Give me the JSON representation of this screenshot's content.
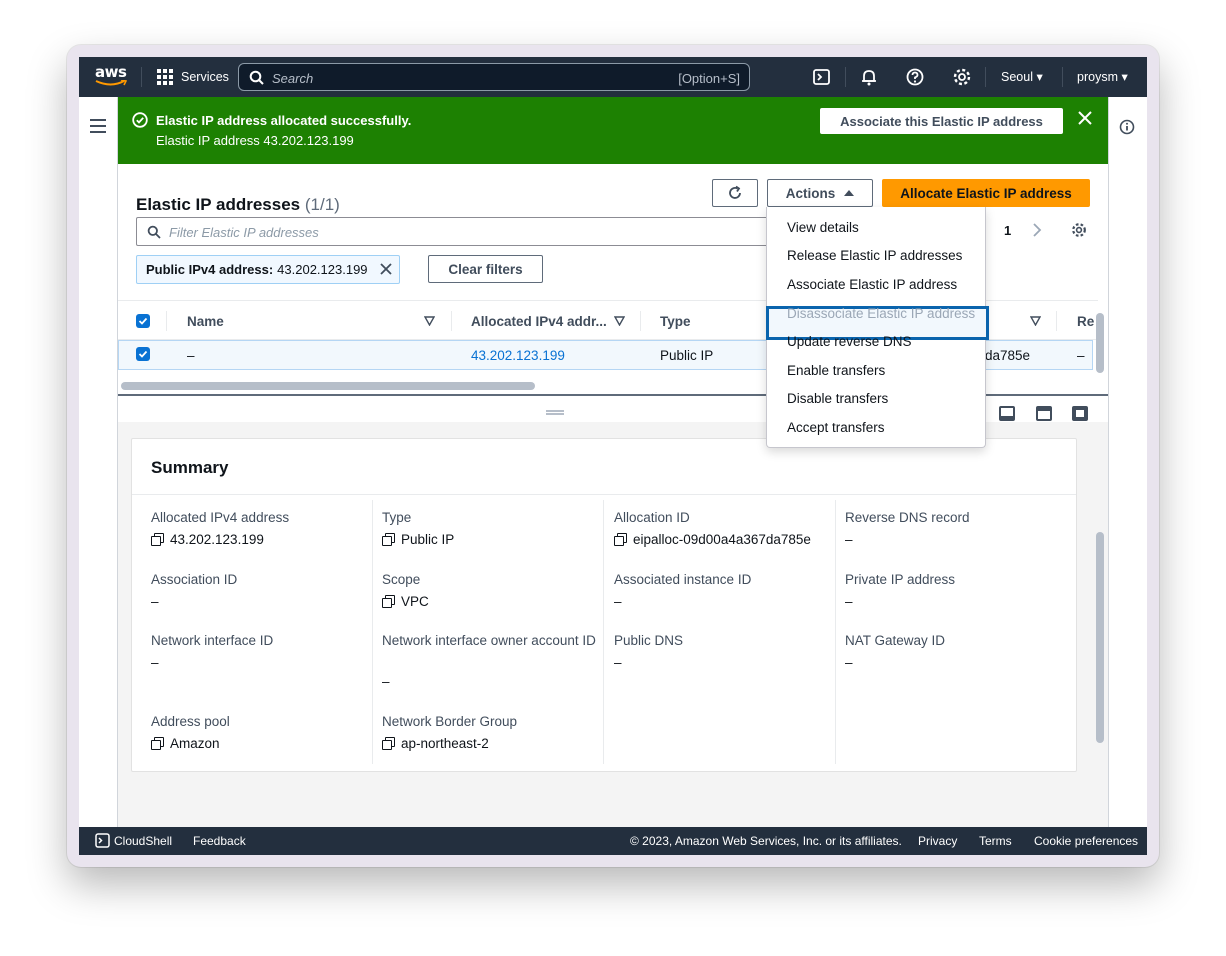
{
  "nav": {
    "logo_text": "aws",
    "services_label": "Services",
    "search_placeholder": "Search",
    "search_shortcut": "[Option+S]",
    "region": "Seoul",
    "user": "proysm"
  },
  "flash": {
    "title": "Elastic IP address allocated successfully.",
    "message": "Elastic IP address 43.202.123.199",
    "action_label": "Associate this Elastic IP address"
  },
  "header": {
    "title": "Elastic IP addresses",
    "count": "(1/1)",
    "actions_label": "Actions",
    "allocate_label": "Allocate Elastic IP address"
  },
  "filter": {
    "placeholder": "Filter Elastic IP addresses",
    "page": "1",
    "token_key": "Public IPv4 address:",
    "token_value": "43.202.123.199",
    "clear_label": "Clear filters"
  },
  "table": {
    "columns": [
      "Name",
      "Allocated IPv4 addr...",
      "Type",
      "Re"
    ],
    "row": {
      "name": "–",
      "ip": "43.202.123.199",
      "type": "Public IP",
      "alloc_tail": "da785e",
      "reverse": "–"
    }
  },
  "actions_menu": {
    "items": [
      {
        "label": "View details",
        "disabled": false
      },
      {
        "label": "Release Elastic IP addresses",
        "disabled": false
      },
      {
        "label": "Associate Elastic IP address",
        "disabled": false,
        "highlighted": true
      },
      {
        "label": "Disassociate Elastic IP address",
        "disabled": true
      },
      {
        "label": "Update reverse DNS",
        "disabled": false
      },
      {
        "label": "Enable transfers",
        "disabled": false
      },
      {
        "label": "Disable transfers",
        "disabled": false
      },
      {
        "label": "Accept transfers",
        "disabled": false
      }
    ]
  },
  "summary": {
    "title": "Summary",
    "allocated_ipv4_label": "Allocated IPv4 address",
    "allocated_ipv4_value": "43.202.123.199",
    "type_label": "Type",
    "type_value": "Public IP",
    "allocation_id_label": "Allocation ID",
    "allocation_id_value": "eipalloc-09d00a4a367da785e",
    "reverse_dns_label": "Reverse DNS record",
    "reverse_dns_value": "–",
    "association_id_label": "Association ID",
    "association_id_value": "–",
    "scope_label": "Scope",
    "scope_value": "VPC",
    "assoc_instance_label": "Associated instance ID",
    "assoc_instance_value": "–",
    "private_ip_label": "Private IP address",
    "private_ip_value": "–",
    "eni_label": "Network interface ID",
    "eni_value": "–",
    "eni_owner_label": "Network interface owner account ID",
    "eni_owner_value": "–",
    "public_dns_label": "Public DNS",
    "public_dns_value": "–",
    "nat_label": "NAT Gateway ID",
    "nat_value": "–",
    "pool_label": "Address pool",
    "pool_value": "Amazon",
    "nbg_label": "Network Border Group",
    "nbg_value": "ap-northeast-2"
  },
  "footer": {
    "cloudshell": "CloudShell",
    "feedback": "Feedback",
    "copyright": "© 2023, Amazon Web Services, Inc. or its affiliates.",
    "privacy": "Privacy",
    "terms": "Terms",
    "cookies": "Cookie preferences"
  },
  "colors": {
    "nav_bg": "#232f3e",
    "success": "#1d8102",
    "primary": "#ff9900",
    "link": "#0972d3",
    "highlight_border": "#0a64ad"
  }
}
